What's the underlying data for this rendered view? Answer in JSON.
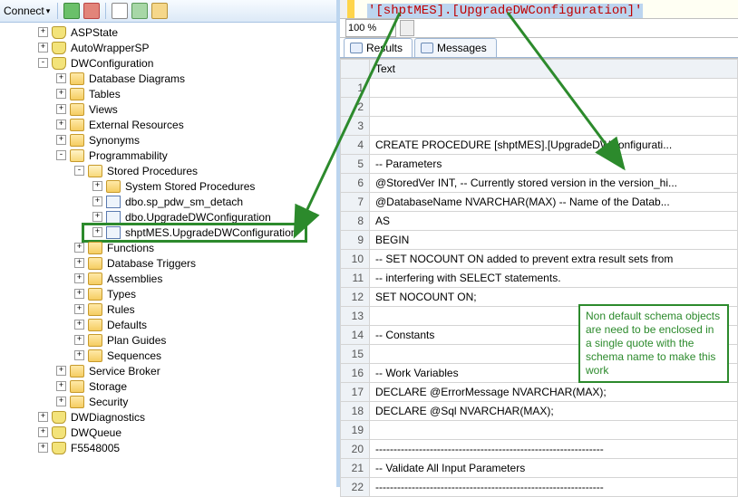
{
  "toolbar": {
    "connect_label": "Connect"
  },
  "tree": {
    "aspstate": "ASPState",
    "autowrappersp": "AutoWrapperSP",
    "dwconfig": "DWConfiguration",
    "dbdiagrams": "Database Diagrams",
    "tables": "Tables",
    "views": "Views",
    "extres": "External Resources",
    "synonyms": "Synonyms",
    "programmability": "Programmability",
    "stored_procs": "Stored Procedures",
    "sys_sp": "System Stored Procedures",
    "sp_detach": "dbo.sp_pdw_sm_detach",
    "sp_upgrade_dbo": "dbo.UpgradeDWConfiguration",
    "sp_upgrade_mes": "shptMES.UpgradeDWConfiguration",
    "functions": "Functions",
    "dbtriggers": "Database Triggers",
    "assemblies": "Assemblies",
    "types": "Types",
    "rules": "Rules",
    "defaults": "Defaults",
    "planguides": "Plan Guides",
    "sequences": "Sequences",
    "service_broker": "Service Broker",
    "storage": "Storage",
    "security": "Security",
    "dwdiagnostics": "DWDiagnostics",
    "dwqueue": "DWQueue",
    "f5548005": "F5548005"
  },
  "editor": {
    "quoted_label": "'[shptMES].[UpgradeDWConfiguration]'",
    "zoom": "100 %"
  },
  "tabs": {
    "results": "Results",
    "messages": "Messages"
  },
  "grid": {
    "header": "Text",
    "rows": [
      "",
      "",
      "",
      "CREATE PROCEDURE [shptMES].[UpgradeDWConfigurati...",
      "-- Parameters",
      "@StoredVer INT, -- Currently stored version in the version_hi...",
      "@DatabaseName NVARCHAR(MAX) -- Name of the Datab...",
      "AS",
      "BEGIN",
      "-- SET NOCOUNT ON added to prevent extra result sets from",
      "-- interfering with SELECT statements.",
      "SET NOCOUNT ON;",
      "",
      "-- Constants",
      "",
      "-- Work Variables",
      "DECLARE @ErrorMessage NVARCHAR(MAX);",
      "DECLARE @Sql NVARCHAR(MAX);",
      "",
      "---------------------------------------------------------------",
      "-- Validate All Input Parameters",
      "---------------------------------------------------------------"
    ]
  },
  "note": "Non default schema objects are need to be enclosed in a single quote with the schema name to make this work"
}
